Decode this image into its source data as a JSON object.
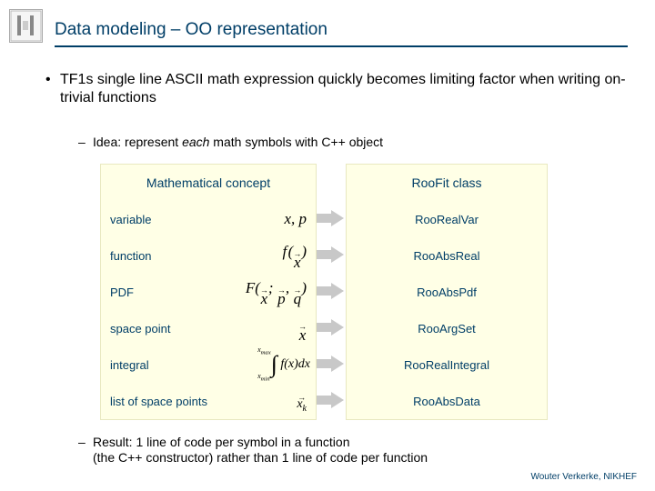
{
  "title": "Data modeling – OO representation",
  "bullets": {
    "main": "TF1s single line ASCII math expression quickly becomes limiting factor when writing on-trivial functions",
    "idea_prefix": "Idea: represent ",
    "idea_em": "each",
    "idea_suffix": " math symbols with C++ object",
    "result_line1": "Result: 1 line of code per symbol in a function",
    "result_line2": "(the C++ constructor) rather than 1 line of code per function"
  },
  "table": {
    "left_header": "Mathematical concept",
    "right_header": "RooFit class",
    "rows": [
      {
        "label": "variable",
        "math": "x, p",
        "cls": "RooRealVar"
      },
      {
        "label": "function",
        "math": "f(x)",
        "cls": "RooAbsReal"
      },
      {
        "label": "PDF",
        "math": "F(x; p, q)",
        "cls": "RooAbsPdf"
      },
      {
        "label": "space point",
        "math": "x",
        "cls": "RooArgSet"
      },
      {
        "label": "integral",
        "math": "∫ f(x) dx",
        "cls": "RooRealIntegral"
      },
      {
        "label": "list of space points",
        "math": "x_k",
        "cls": "RooAbsData"
      }
    ]
  },
  "footer": "Wouter Verkerke, NIKHEF"
}
